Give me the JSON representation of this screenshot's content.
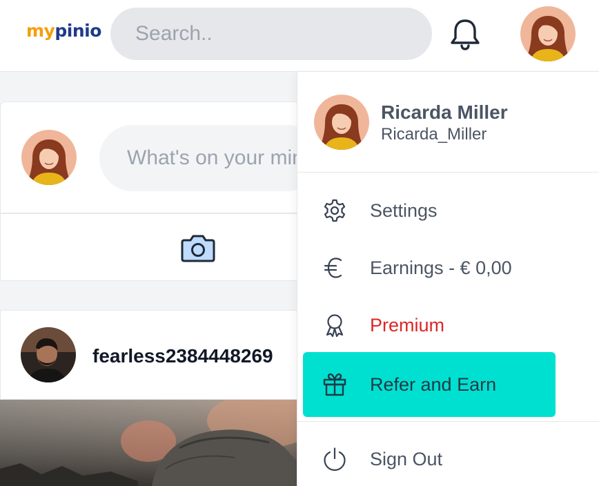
{
  "header": {
    "logo_part1": "my",
    "logo_part2": "pinio",
    "search_placeholder": "Search..",
    "notification_icon": "bell-icon",
    "avatar_icon": "user-avatar"
  },
  "composer": {
    "placeholder": "What's on your mind",
    "media_icon": "camera-icon"
  },
  "post": {
    "username": "fearless2384448269"
  },
  "profile_menu": {
    "name": "Ricarda Miller",
    "handle": "Ricarda_Miller",
    "items": [
      {
        "label": "Settings",
        "icon": "gear-icon"
      },
      {
        "label": "Earnings - € 0,00",
        "icon": "euro-icon"
      },
      {
        "label": "Premium",
        "icon": "award-icon"
      },
      {
        "label": "Refer and Earn",
        "icon": "gift-icon"
      },
      {
        "label": "Sign Out",
        "icon": "power-icon"
      }
    ]
  },
  "colors": {
    "logo_orange": "#f59e0b",
    "logo_navy": "#1e3a8a",
    "premium_red": "#dc2626",
    "refer_highlight": "#00e0d0"
  }
}
